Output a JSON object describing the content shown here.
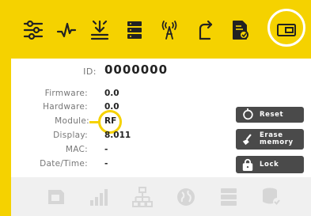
{
  "toolbar": {
    "icons": [
      "sliders-icon",
      "signal-pulse-icon",
      "download-tray-icon",
      "server-stack-icon",
      "broadcast-tower-icon",
      "route-arrow-icon",
      "document-check-icon",
      "device-screen-icon"
    ],
    "active_icon": "device-screen-icon"
  },
  "device": {
    "id_label": "ID:",
    "id_value": "0000000",
    "fields": [
      {
        "label": "Firmware:",
        "value": "0.0"
      },
      {
        "label": "Hardware:",
        "value": "0.0"
      },
      {
        "label": "Module:",
        "value": "RF"
      },
      {
        "label": "Display:",
        "value": "8.011"
      },
      {
        "label": "MAC:",
        "value": "-"
      },
      {
        "label": "Date/Time:",
        "value": "-"
      }
    ]
  },
  "actions": {
    "reset_label": "Reset",
    "erase_label_line1": "Erase",
    "erase_label_line2": "memory",
    "lock_label": "Lock"
  },
  "bottom_bar": {
    "icons": [
      "sim-card-icon",
      "signal-bars-icon",
      "network-tree-icon",
      "globe-icon",
      "server-icon",
      "database-check-icon"
    ]
  },
  "colors": {
    "accent": "#f5d200",
    "button_bg": "#4a4a4a",
    "disabled_icon": "#d6d6d6"
  }
}
